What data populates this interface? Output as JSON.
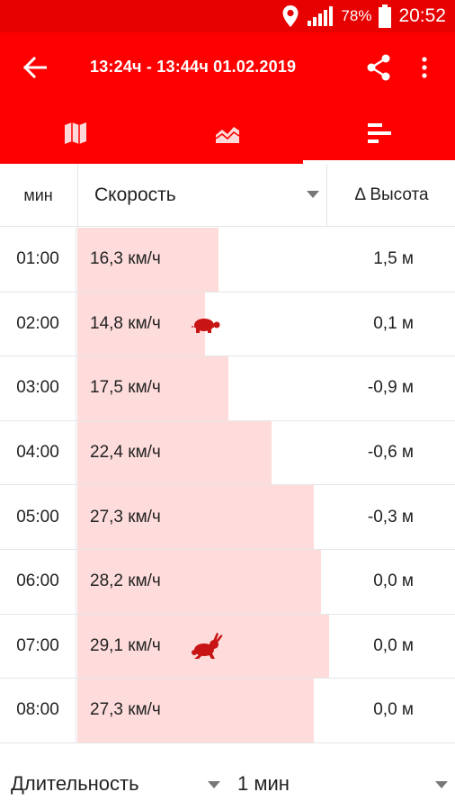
{
  "status_bar": {
    "battery": "78%",
    "time": "20:52"
  },
  "app_bar": {
    "title": "13:24ч - 13:44ч   01.02.2019"
  },
  "tabs": [
    {
      "icon": "map-icon",
      "selected": false
    },
    {
      "icon": "chart-area-icon",
      "selected": false
    },
    {
      "icon": "bar-list-icon",
      "selected": true
    }
  ],
  "table": {
    "headers": {
      "minute": "мин",
      "metric": "Скорость",
      "altitude": "Δ Высота"
    },
    "max_speed_kmh": 29.1,
    "rows": [
      {
        "time": "01:00",
        "speed": "16,3 км/ч",
        "speed_value": 16.3,
        "altitude": "1,5 м",
        "marker": ""
      },
      {
        "time": "02:00",
        "speed": "14,8 км/ч",
        "speed_value": 14.8,
        "altitude": "0,1 м",
        "marker": "turtle-icon"
      },
      {
        "time": "03:00",
        "speed": "17,5 км/ч",
        "speed_value": 17.5,
        "altitude": "-0,9 м",
        "marker": ""
      },
      {
        "time": "04:00",
        "speed": "22,4 км/ч",
        "speed_value": 22.4,
        "altitude": "-0,6 м",
        "marker": ""
      },
      {
        "time": "05:00",
        "speed": "27,3 км/ч",
        "speed_value": 27.3,
        "altitude": "-0,3 м",
        "marker": ""
      },
      {
        "time": "06:00",
        "speed": "28,2 км/ч",
        "speed_value": 28.2,
        "altitude": "0,0 м",
        "marker": ""
      },
      {
        "time": "07:00",
        "speed": "29,1 км/ч",
        "speed_value": 29.1,
        "altitude": "0,0 м",
        "marker": "rabbit-icon"
      },
      {
        "time": "08:00",
        "speed": "27,3 км/ч",
        "speed_value": 27.3,
        "altitude": "0,0 м",
        "marker": ""
      }
    ]
  },
  "footer": {
    "label": "Длительность",
    "value": "1 мин"
  },
  "colors": {
    "primary": "#ff0000",
    "status_bar": "#e60000",
    "bar_fill": "#ffdcdc",
    "marker": "#c81414"
  }
}
